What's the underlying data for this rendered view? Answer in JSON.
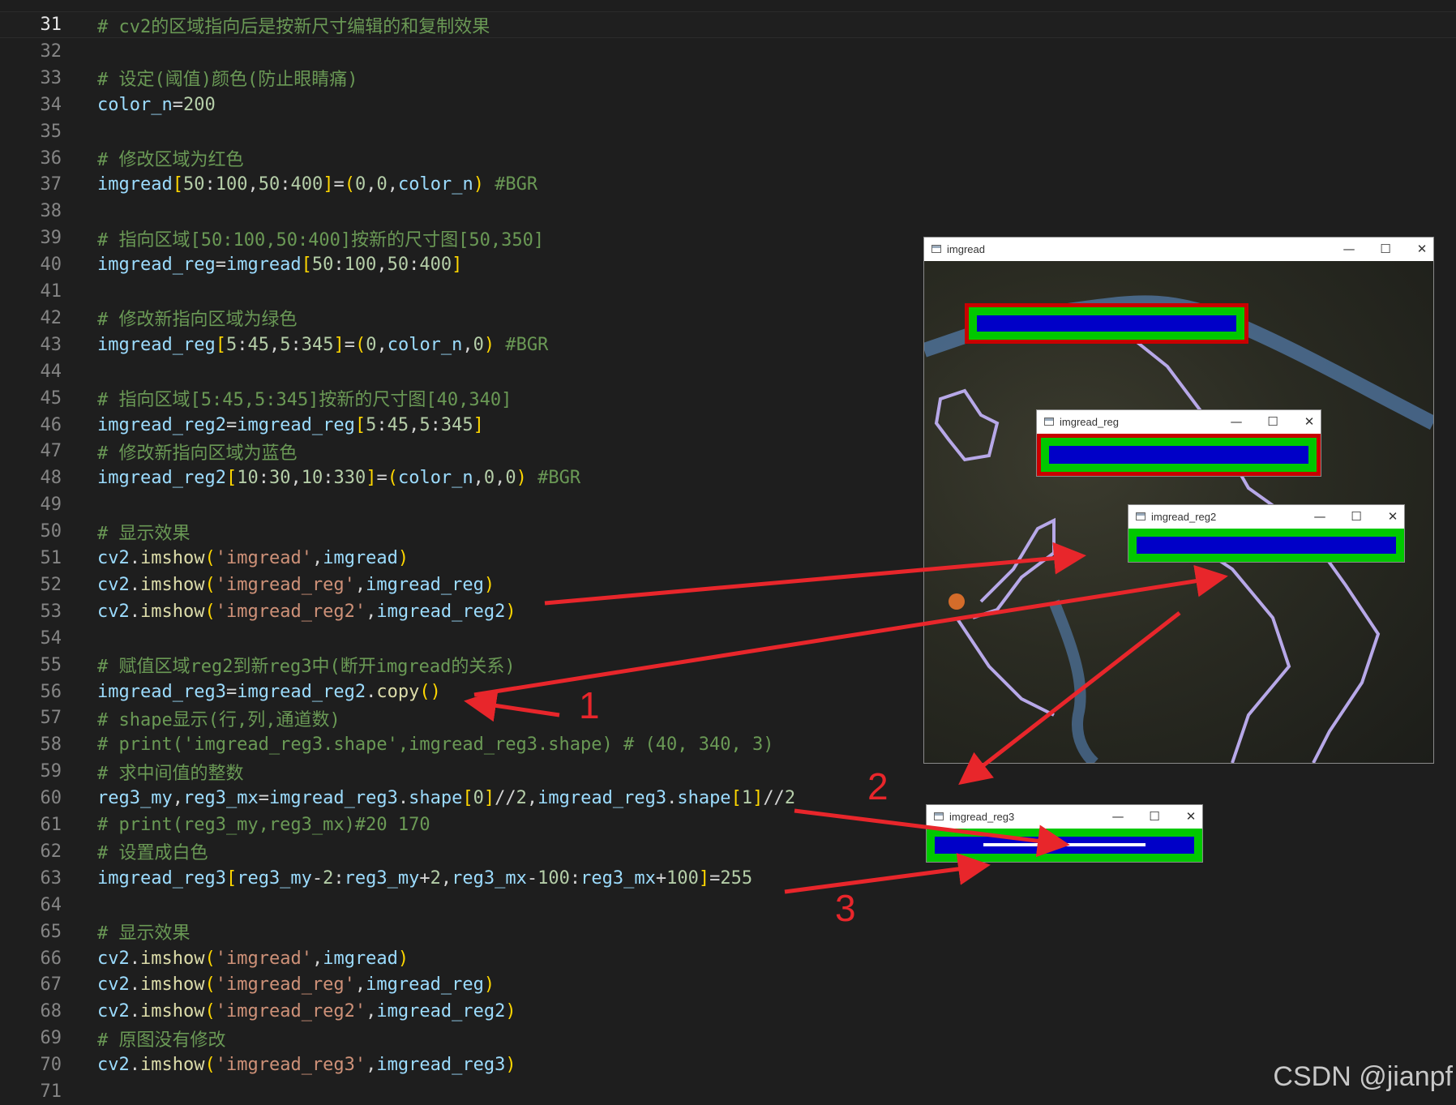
{
  "editor": {
    "lines": [
      {
        "n": "31",
        "current": true,
        "tokens": [
          {
            "t": "com",
            "v": "# cv2的区域指向后是按新尺寸编辑的和复制效果"
          }
        ]
      },
      {
        "n": "32",
        "tokens": []
      },
      {
        "n": "33",
        "tokens": [
          {
            "t": "com",
            "v": "# 设定(阈值)颜色(防止眼睛痛)"
          }
        ]
      },
      {
        "n": "34",
        "tokens": [
          {
            "t": "var",
            "v": "color_n"
          },
          {
            "t": "op",
            "v": "="
          },
          {
            "t": "num",
            "v": "200"
          }
        ]
      },
      {
        "n": "35",
        "tokens": []
      },
      {
        "n": "36",
        "tokens": [
          {
            "t": "com",
            "v": "# 修改区域为红色"
          }
        ]
      },
      {
        "n": "37",
        "tokens": [
          {
            "t": "var",
            "v": "imgread"
          },
          {
            "t": "br1",
            "v": "["
          },
          {
            "t": "num",
            "v": "50"
          },
          {
            "t": "op",
            "v": ":"
          },
          {
            "t": "num",
            "v": "100"
          },
          {
            "t": "op",
            "v": ","
          },
          {
            "t": "num",
            "v": "50"
          },
          {
            "t": "op",
            "v": ":"
          },
          {
            "t": "num",
            "v": "400"
          },
          {
            "t": "br1",
            "v": "]"
          },
          {
            "t": "op",
            "v": "="
          },
          {
            "t": "br1",
            "v": "("
          },
          {
            "t": "num",
            "v": "0"
          },
          {
            "t": "op",
            "v": ","
          },
          {
            "t": "num",
            "v": "0"
          },
          {
            "t": "op",
            "v": ","
          },
          {
            "t": "var",
            "v": "color_n"
          },
          {
            "t": "br1",
            "v": ")"
          },
          {
            "t": "op",
            "v": " "
          },
          {
            "t": "com",
            "v": "#BGR"
          }
        ]
      },
      {
        "n": "38",
        "tokens": []
      },
      {
        "n": "39",
        "tokens": [
          {
            "t": "com",
            "v": "# 指向区域[50:100,50:400]按新的尺寸图[50,350]"
          }
        ]
      },
      {
        "n": "40",
        "tokens": [
          {
            "t": "var",
            "v": "imgread_reg"
          },
          {
            "t": "op",
            "v": "="
          },
          {
            "t": "var",
            "v": "imgread"
          },
          {
            "t": "br1",
            "v": "["
          },
          {
            "t": "num",
            "v": "50"
          },
          {
            "t": "op",
            "v": ":"
          },
          {
            "t": "num",
            "v": "100"
          },
          {
            "t": "op",
            "v": ","
          },
          {
            "t": "num",
            "v": "50"
          },
          {
            "t": "op",
            "v": ":"
          },
          {
            "t": "num",
            "v": "400"
          },
          {
            "t": "br1",
            "v": "]"
          }
        ]
      },
      {
        "n": "41",
        "tokens": []
      },
      {
        "n": "42",
        "tokens": [
          {
            "t": "com",
            "v": "# 修改新指向区域为绿色"
          }
        ]
      },
      {
        "n": "43",
        "tokens": [
          {
            "t": "var",
            "v": "imgread_reg"
          },
          {
            "t": "br1",
            "v": "["
          },
          {
            "t": "num",
            "v": "5"
          },
          {
            "t": "op",
            "v": ":"
          },
          {
            "t": "num",
            "v": "45"
          },
          {
            "t": "op",
            "v": ","
          },
          {
            "t": "num",
            "v": "5"
          },
          {
            "t": "op",
            "v": ":"
          },
          {
            "t": "num",
            "v": "345"
          },
          {
            "t": "br1",
            "v": "]"
          },
          {
            "t": "op",
            "v": "="
          },
          {
            "t": "br1",
            "v": "("
          },
          {
            "t": "num",
            "v": "0"
          },
          {
            "t": "op",
            "v": ","
          },
          {
            "t": "var",
            "v": "color_n"
          },
          {
            "t": "op",
            "v": ","
          },
          {
            "t": "num",
            "v": "0"
          },
          {
            "t": "br1",
            "v": ")"
          },
          {
            "t": "op",
            "v": " "
          },
          {
            "t": "com",
            "v": "#BGR"
          }
        ]
      },
      {
        "n": "44",
        "tokens": []
      },
      {
        "n": "45",
        "tokens": [
          {
            "t": "com",
            "v": "# 指向区域[5:45,5:345]按新的尺寸图[40,340]"
          }
        ]
      },
      {
        "n": "46",
        "tokens": [
          {
            "t": "var",
            "v": "imgread_reg2"
          },
          {
            "t": "op",
            "v": "="
          },
          {
            "t": "var",
            "v": "imgread_reg"
          },
          {
            "t": "br1",
            "v": "["
          },
          {
            "t": "num",
            "v": "5"
          },
          {
            "t": "op",
            "v": ":"
          },
          {
            "t": "num",
            "v": "45"
          },
          {
            "t": "op",
            "v": ","
          },
          {
            "t": "num",
            "v": "5"
          },
          {
            "t": "op",
            "v": ":"
          },
          {
            "t": "num",
            "v": "345"
          },
          {
            "t": "br1",
            "v": "]"
          }
        ]
      },
      {
        "n": "47",
        "tokens": [
          {
            "t": "com",
            "v": "# 修改新指向区域为蓝色"
          }
        ]
      },
      {
        "n": "48",
        "tokens": [
          {
            "t": "var",
            "v": "imgread_reg2"
          },
          {
            "t": "br1",
            "v": "["
          },
          {
            "t": "num",
            "v": "10"
          },
          {
            "t": "op",
            "v": ":"
          },
          {
            "t": "num",
            "v": "30"
          },
          {
            "t": "op",
            "v": ","
          },
          {
            "t": "num",
            "v": "10"
          },
          {
            "t": "op",
            "v": ":"
          },
          {
            "t": "num",
            "v": "330"
          },
          {
            "t": "br1",
            "v": "]"
          },
          {
            "t": "op",
            "v": "="
          },
          {
            "t": "br1",
            "v": "("
          },
          {
            "t": "var",
            "v": "color_n"
          },
          {
            "t": "op",
            "v": ","
          },
          {
            "t": "num",
            "v": "0"
          },
          {
            "t": "op",
            "v": ","
          },
          {
            "t": "num",
            "v": "0"
          },
          {
            "t": "br1",
            "v": ")"
          },
          {
            "t": "op",
            "v": " "
          },
          {
            "t": "com",
            "v": "#BGR"
          }
        ]
      },
      {
        "n": "49",
        "tokens": []
      },
      {
        "n": "50",
        "tokens": [
          {
            "t": "com",
            "v": "# 显示效果"
          }
        ]
      },
      {
        "n": "51",
        "tokens": [
          {
            "t": "var",
            "v": "cv2"
          },
          {
            "t": "op",
            "v": "."
          },
          {
            "t": "fn",
            "v": "imshow"
          },
          {
            "t": "br1",
            "v": "("
          },
          {
            "t": "str",
            "v": "'imgread'"
          },
          {
            "t": "op",
            "v": ","
          },
          {
            "t": "var",
            "v": "imgread"
          },
          {
            "t": "br1",
            "v": ")"
          }
        ]
      },
      {
        "n": "52",
        "tokens": [
          {
            "t": "var",
            "v": "cv2"
          },
          {
            "t": "op",
            "v": "."
          },
          {
            "t": "fn",
            "v": "imshow"
          },
          {
            "t": "br1",
            "v": "("
          },
          {
            "t": "str",
            "v": "'imgread_reg'"
          },
          {
            "t": "op",
            "v": ","
          },
          {
            "t": "var",
            "v": "imgread_reg"
          },
          {
            "t": "br1",
            "v": ")"
          }
        ]
      },
      {
        "n": "53",
        "tokens": [
          {
            "t": "var",
            "v": "cv2"
          },
          {
            "t": "op",
            "v": "."
          },
          {
            "t": "fn",
            "v": "imshow"
          },
          {
            "t": "br1",
            "v": "("
          },
          {
            "t": "str",
            "v": "'imgread_reg2'"
          },
          {
            "t": "op",
            "v": ","
          },
          {
            "t": "var",
            "v": "imgread_reg2"
          },
          {
            "t": "br1",
            "v": ")"
          }
        ]
      },
      {
        "n": "54",
        "tokens": []
      },
      {
        "n": "55",
        "tokens": [
          {
            "t": "com",
            "v": "# 赋值区域reg2到新reg3中(断开imgread的关系)"
          }
        ]
      },
      {
        "n": "56",
        "tokens": [
          {
            "t": "var",
            "v": "imgread_reg3"
          },
          {
            "t": "op",
            "v": "="
          },
          {
            "t": "var",
            "v": "imgread_reg2"
          },
          {
            "t": "op",
            "v": "."
          },
          {
            "t": "fn",
            "v": "copy"
          },
          {
            "t": "br1",
            "v": "()"
          }
        ]
      },
      {
        "n": "57",
        "tokens": [
          {
            "t": "com",
            "v": "# shape显示(行,列,通道数)"
          }
        ]
      },
      {
        "n": "58",
        "tokens": [
          {
            "t": "com",
            "v": "# print('imgread_reg3.shape',imgread_reg3.shape) # (40, 340, 3)"
          }
        ]
      },
      {
        "n": "59",
        "tokens": [
          {
            "t": "com",
            "v": "# 求中间值的整数"
          }
        ]
      },
      {
        "n": "60",
        "tokens": [
          {
            "t": "var",
            "v": "reg3_my"
          },
          {
            "t": "op",
            "v": ","
          },
          {
            "t": "var",
            "v": "reg3_mx"
          },
          {
            "t": "op",
            "v": "="
          },
          {
            "t": "var",
            "v": "imgread_reg3"
          },
          {
            "t": "op",
            "v": "."
          },
          {
            "t": "var",
            "v": "shape"
          },
          {
            "t": "br1",
            "v": "["
          },
          {
            "t": "num",
            "v": "0"
          },
          {
            "t": "br1",
            "v": "]"
          },
          {
            "t": "op",
            "v": "//"
          },
          {
            "t": "num",
            "v": "2"
          },
          {
            "t": "op",
            "v": ","
          },
          {
            "t": "var",
            "v": "imgread_reg3"
          },
          {
            "t": "op",
            "v": "."
          },
          {
            "t": "var",
            "v": "shape"
          },
          {
            "t": "br1",
            "v": "["
          },
          {
            "t": "num",
            "v": "1"
          },
          {
            "t": "br1",
            "v": "]"
          },
          {
            "t": "op",
            "v": "//"
          },
          {
            "t": "num",
            "v": "2"
          }
        ]
      },
      {
        "n": "61",
        "tokens": [
          {
            "t": "com",
            "v": "# print(reg3_my,reg3_mx)#20 170"
          }
        ]
      },
      {
        "n": "62",
        "tokens": [
          {
            "t": "com",
            "v": "# 设置成白色"
          }
        ]
      },
      {
        "n": "63",
        "tokens": [
          {
            "t": "var",
            "v": "imgread_reg3"
          },
          {
            "t": "br1",
            "v": "["
          },
          {
            "t": "var",
            "v": "reg3_my"
          },
          {
            "t": "op",
            "v": "-"
          },
          {
            "t": "num",
            "v": "2"
          },
          {
            "t": "op",
            "v": ":"
          },
          {
            "t": "var",
            "v": "reg3_my"
          },
          {
            "t": "op",
            "v": "+"
          },
          {
            "t": "num",
            "v": "2"
          },
          {
            "t": "op",
            "v": ","
          },
          {
            "t": "var",
            "v": "reg3_mx"
          },
          {
            "t": "op",
            "v": "-"
          },
          {
            "t": "num",
            "v": "100"
          },
          {
            "t": "op",
            "v": ":"
          },
          {
            "t": "var",
            "v": "reg3_mx"
          },
          {
            "t": "op",
            "v": "+"
          },
          {
            "t": "num",
            "v": "100"
          },
          {
            "t": "br1",
            "v": "]"
          },
          {
            "t": "op",
            "v": "="
          },
          {
            "t": "num",
            "v": "255"
          }
        ]
      },
      {
        "n": "64",
        "tokens": []
      },
      {
        "n": "65",
        "tokens": [
          {
            "t": "com",
            "v": "# 显示效果"
          }
        ]
      },
      {
        "n": "66",
        "tokens": [
          {
            "t": "var",
            "v": "cv2"
          },
          {
            "t": "op",
            "v": "."
          },
          {
            "t": "fn",
            "v": "imshow"
          },
          {
            "t": "br1",
            "v": "("
          },
          {
            "t": "str",
            "v": "'imgread'"
          },
          {
            "t": "op",
            "v": ","
          },
          {
            "t": "var",
            "v": "imgread"
          },
          {
            "t": "br1",
            "v": ")"
          }
        ]
      },
      {
        "n": "67",
        "tokens": [
          {
            "t": "var",
            "v": "cv2"
          },
          {
            "t": "op",
            "v": "."
          },
          {
            "t": "fn",
            "v": "imshow"
          },
          {
            "t": "br1",
            "v": "("
          },
          {
            "t": "str",
            "v": "'imgread_reg'"
          },
          {
            "t": "op",
            "v": ","
          },
          {
            "t": "var",
            "v": "imgread_reg"
          },
          {
            "t": "br1",
            "v": ")"
          }
        ]
      },
      {
        "n": "68",
        "tokens": [
          {
            "t": "var",
            "v": "cv2"
          },
          {
            "t": "op",
            "v": "."
          },
          {
            "t": "fn",
            "v": "imshow"
          },
          {
            "t": "br1",
            "v": "("
          },
          {
            "t": "str",
            "v": "'imgread_reg2'"
          },
          {
            "t": "op",
            "v": ","
          },
          {
            "t": "var",
            "v": "imgread_reg2"
          },
          {
            "t": "br1",
            "v": ")"
          }
        ]
      },
      {
        "n": "69",
        "tokens": [
          {
            "t": "com",
            "v": "# 原图没有修改"
          }
        ]
      },
      {
        "n": "70",
        "tokens": [
          {
            "t": "var",
            "v": "cv2"
          },
          {
            "t": "op",
            "v": "."
          },
          {
            "t": "fn",
            "v": "imshow"
          },
          {
            "t": "br1",
            "v": "("
          },
          {
            "t": "str",
            "v": "'imgread_reg3'"
          },
          {
            "t": "op",
            "v": ","
          },
          {
            "t": "var",
            "v": "imgread_reg3"
          },
          {
            "t": "br1",
            "v": ")"
          }
        ]
      },
      {
        "n": "71",
        "tokens": []
      }
    ]
  },
  "windows": {
    "imgread": {
      "title": "imgread"
    },
    "imgread_reg": {
      "title": "imgread_reg"
    },
    "imgread_reg2": {
      "title": "imgread_reg2"
    },
    "imgread_reg3": {
      "title": "imgread_reg3"
    },
    "controls": {
      "minimize": "—",
      "maximize": "☐",
      "close": "✕"
    }
  },
  "annotations": {
    "label_1": "1",
    "label_2": "2",
    "label_3": "3"
  },
  "colors": {
    "red_region": "#c80000",
    "green_region": "#00c800",
    "blue_region": "#0000c8",
    "arrow": "#e8262b",
    "white_line": "#ffffff"
  },
  "watermark": "CSDN @jianpf"
}
